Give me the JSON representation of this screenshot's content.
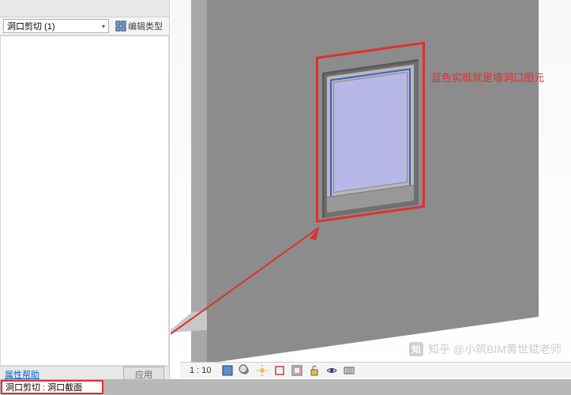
{
  "panel": {
    "type_selector": "洞口剪切 (1)",
    "edit_type_label": "编辑类型",
    "help_link": "属性帮助",
    "apply_label": "应用"
  },
  "annotation": {
    "callout_text": "蓝色实框就是墙洞口图元"
  },
  "status": {
    "selection_text": "洞口剪切 : 洞口截面"
  },
  "view_controls": {
    "scale": "1 : 10"
  },
  "watermark": {
    "text": "知乎 @小筑BIM黄世斌老师"
  },
  "icons": {
    "edit_type": "edit-type-icon",
    "vc": [
      "model-graphics-icon",
      "shadows-icon",
      "crop-icon",
      "crop-region-icon",
      "section-box-icon",
      "render-icon",
      "reveal-icon",
      "settings-icon"
    ]
  }
}
